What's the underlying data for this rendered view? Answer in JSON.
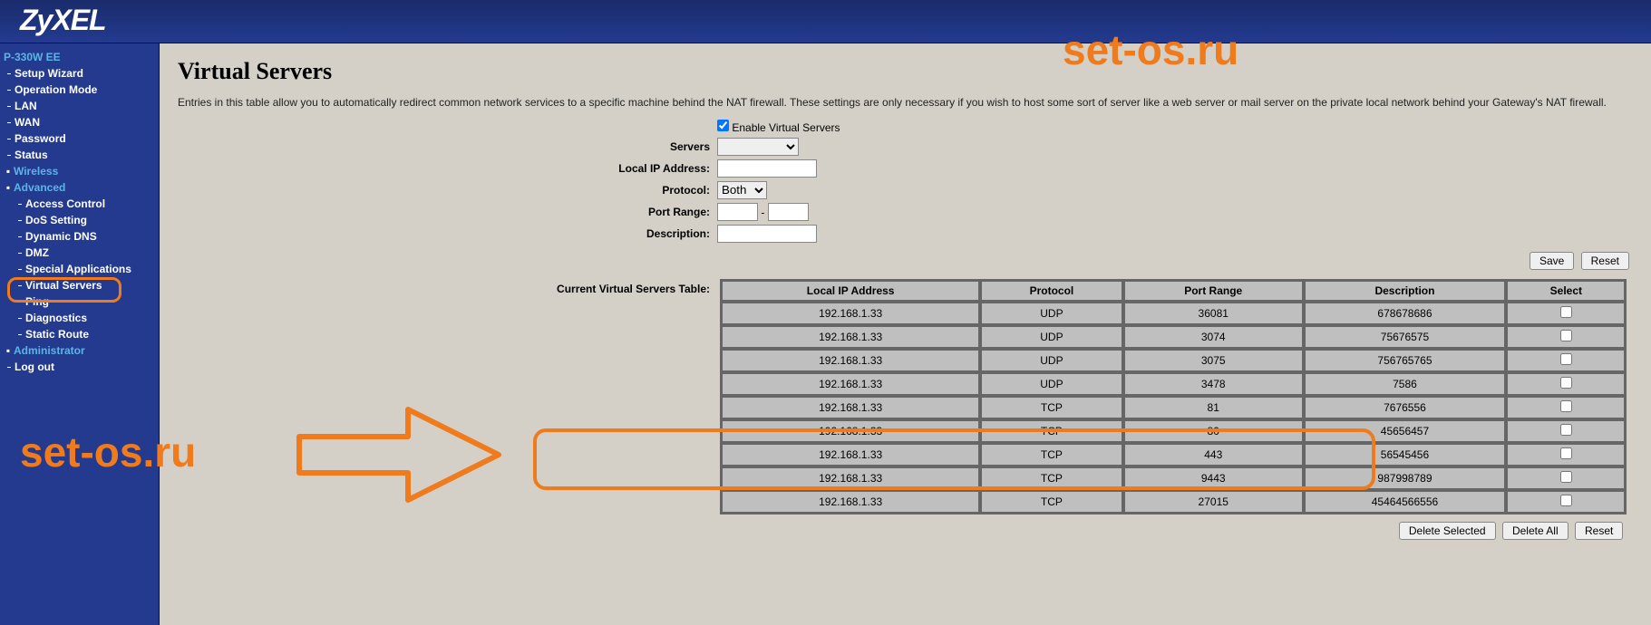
{
  "brand": "ZyXEL",
  "watermark": "set-os.ru",
  "sidebar": {
    "model": "P-330W EE",
    "items": [
      "Setup Wizard",
      "Operation Mode",
      "LAN",
      "WAN",
      "Password",
      "Status"
    ],
    "wireless_label": "Wireless",
    "advanced_label": "Advanced",
    "advanced_items": [
      "Access Control",
      "DoS Setting",
      "Dynamic DNS",
      "DMZ",
      "Special Applications",
      "Virtual Servers",
      "Ping",
      "Diagnostics",
      "Static Route"
    ],
    "admin_label": "Administrator",
    "logout": "Log out"
  },
  "page": {
    "title": "Virtual Servers",
    "intro": "Entries in this table allow you to automatically redirect common network services to a specific machine behind the NAT firewall. These settings are only necessary if you wish to host some sort of server like a web server or mail server on the private local network behind your Gateway's NAT firewall.",
    "enable_label": "Enable Virtual Servers",
    "enable_checked": true,
    "form": {
      "servers_label": "Servers",
      "servers_value": "",
      "local_ip_label": "Local IP Address:",
      "local_ip_value": "",
      "protocol_label": "Protocol:",
      "protocol_value": "Both",
      "port_range_label": "Port Range:",
      "port_from": "",
      "port_sep": "-",
      "port_to": "",
      "description_label": "Description:",
      "description_value": ""
    },
    "save_btn": "Save",
    "reset_btn": "Reset",
    "table_label": "Current Virtual Servers Table:",
    "columns": [
      "Local IP Address",
      "Protocol",
      "Port Range",
      "Description",
      "Select"
    ],
    "rows": [
      {
        "ip": "192.168.1.33",
        "proto": "UDP",
        "port": "36081",
        "desc": "678678686"
      },
      {
        "ip": "192.168.1.33",
        "proto": "UDP",
        "port": "3074",
        "desc": "75676575"
      },
      {
        "ip": "192.168.1.33",
        "proto": "UDP",
        "port": "3075",
        "desc": "756765765"
      },
      {
        "ip": "192.168.1.33",
        "proto": "UDP",
        "port": "3478",
        "desc": "7586"
      },
      {
        "ip": "192.168.1.33",
        "proto": "TCP",
        "port": "81",
        "desc": "7676556"
      },
      {
        "ip": "192.168.1.33",
        "proto": "TCP",
        "port": "80",
        "desc": "45656457"
      },
      {
        "ip": "192.168.1.33",
        "proto": "TCP",
        "port": "443",
        "desc": "56545456"
      },
      {
        "ip": "192.168.1.33",
        "proto": "TCP",
        "port": "9443",
        "desc": "987998789"
      },
      {
        "ip": "192.168.1.33",
        "proto": "TCP",
        "port": "27015",
        "desc": "45464566556"
      }
    ],
    "delete_selected_btn": "Delete Selected",
    "delete_all_btn": "Delete All",
    "reset2_btn": "Reset"
  }
}
